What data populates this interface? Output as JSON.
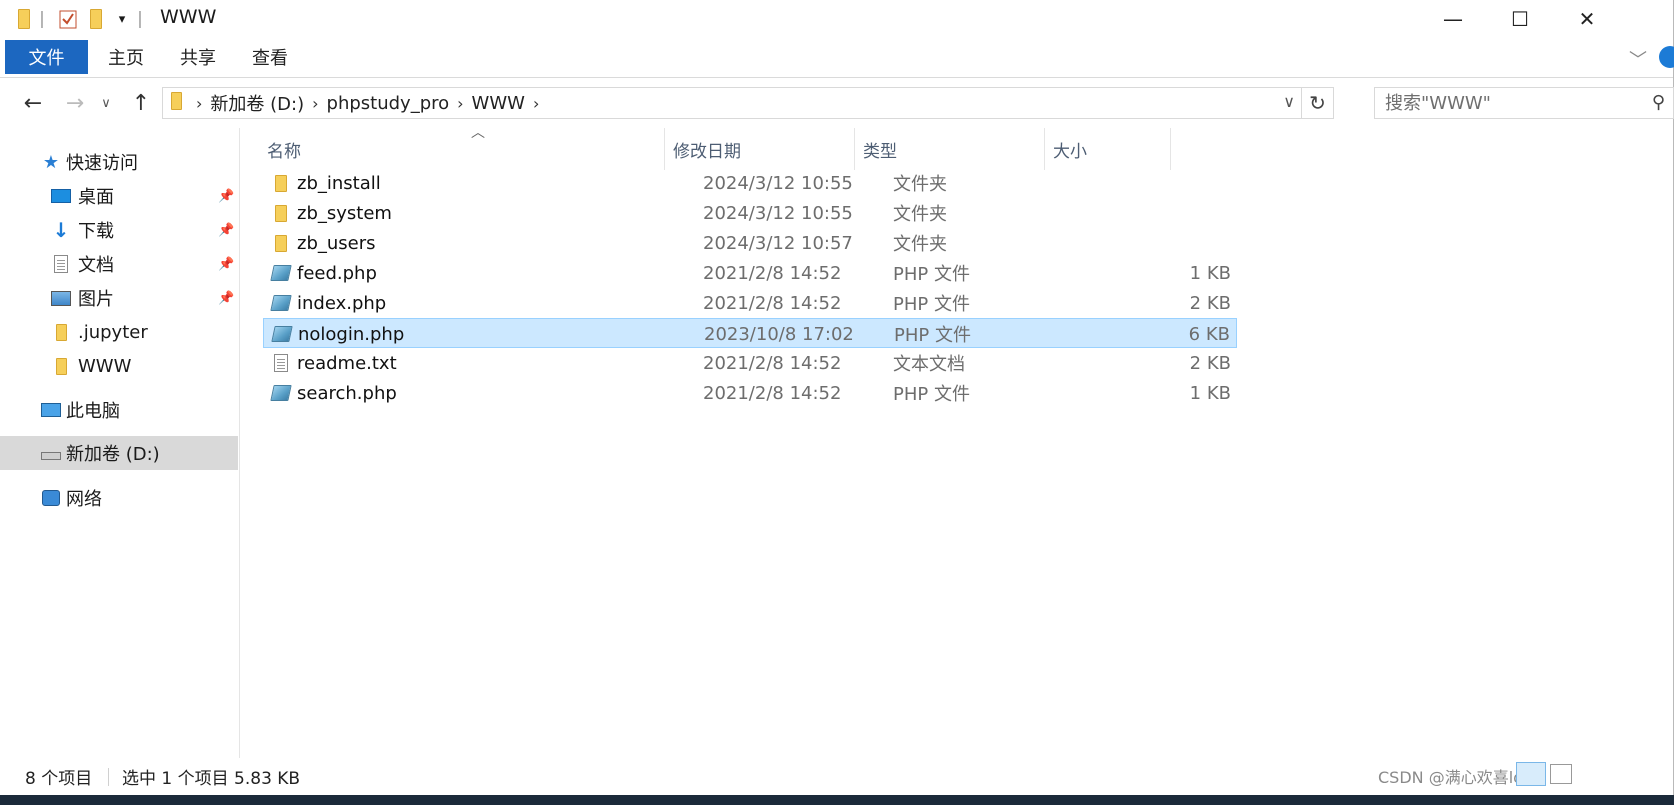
{
  "window": {
    "title": "WWW",
    "minimize": "—",
    "maximize": "☐",
    "close": "✕"
  },
  "ribbon": {
    "tabs": [
      "文件",
      "主页",
      "共享",
      "查看"
    ]
  },
  "address": {
    "crumbs": [
      "新加卷 (D:)",
      "phpstudy_pro",
      "WWW"
    ],
    "search_placeholder": "搜索\"WWW\""
  },
  "nav": {
    "quick_access": "快速访问",
    "quick_items": [
      "桌面",
      "下载",
      "文档",
      "图片",
      ".jupyter",
      "WWW"
    ],
    "this_pc": "此电脑",
    "drive": "新加卷 (D:)",
    "network": "网络"
  },
  "columns": {
    "name": "名称",
    "date": "修改日期",
    "type": "类型",
    "size": "大小"
  },
  "files": [
    {
      "name": "zb_install",
      "date": "2024/3/12 10:55",
      "type": "文件夹",
      "size": "",
      "icon": "folder-icon"
    },
    {
      "name": "zb_system",
      "date": "2024/3/12 10:55",
      "type": "文件夹",
      "size": "",
      "icon": "folder-icon"
    },
    {
      "name": "zb_users",
      "date": "2024/3/12 10:57",
      "type": "文件夹",
      "size": "",
      "icon": "folder-icon"
    },
    {
      "name": "feed.php",
      "date": "2021/2/8 14:52",
      "type": "PHP 文件",
      "size": "1 KB",
      "icon": "php-file-icon"
    },
    {
      "name": "index.php",
      "date": "2021/2/8 14:52",
      "type": "PHP 文件",
      "size": "2 KB",
      "icon": "php-file-icon"
    },
    {
      "name": "nologin.php",
      "date": "2023/10/8 17:02",
      "type": "PHP 文件",
      "size": "6 KB",
      "icon": "php-file-icon",
      "selected": true
    },
    {
      "name": "readme.txt",
      "date": "2021/2/8 14:52",
      "type": "文本文档",
      "size": "2 KB",
      "icon": "text-file-icon"
    },
    {
      "name": "search.php",
      "date": "2021/2/8 14:52",
      "type": "PHP 文件",
      "size": "1 KB",
      "icon": "php-file-icon"
    }
  ],
  "status": {
    "count": "8 个项目",
    "selection": "选中 1 个项目  5.83 KB"
  },
  "watermark": "CSDN @满心欢喜love",
  "colors": {
    "accent": "#1c67c0",
    "selection_bg": "#cce8ff",
    "selection_border": "#99d1ff",
    "folder": "#f6cf5a"
  }
}
